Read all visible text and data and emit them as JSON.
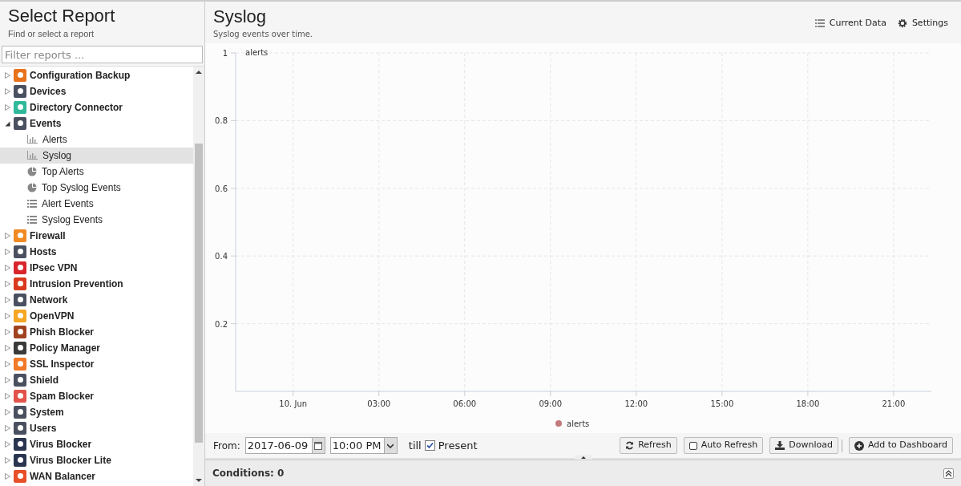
{
  "sidebar": {
    "title": "Select Report",
    "subtitle": "Find or select a report",
    "filter": {
      "placeholder": "Filter reports ..."
    },
    "items": [
      {
        "label": "Configuration Backup",
        "color": "#e8731c",
        "expanded": false
      },
      {
        "label": "Devices",
        "color": "#4a5060",
        "expanded": false
      },
      {
        "label": "Directory Connector",
        "color": "#2fb99a",
        "expanded": false
      },
      {
        "label": "Events",
        "color": "#4a5060",
        "expanded": true,
        "children": [
          {
            "label": "Alerts",
            "kind": "bar",
            "selected": false
          },
          {
            "label": "Syslog",
            "kind": "bar",
            "selected": true
          },
          {
            "label": "Top Alerts",
            "kind": "pie",
            "selected": false
          },
          {
            "label": "Top Syslog Events",
            "kind": "pie",
            "selected": false
          },
          {
            "label": "Alert Events",
            "kind": "list",
            "selected": false
          },
          {
            "label": "Syslog Events",
            "kind": "list",
            "selected": false
          }
        ]
      },
      {
        "label": "Firewall",
        "color": "#f08a24",
        "expanded": false
      },
      {
        "label": "Hosts",
        "color": "#4a5060",
        "expanded": false
      },
      {
        "label": "IPsec VPN",
        "color": "#d9262c",
        "expanded": false
      },
      {
        "label": "Intrusion Prevention",
        "color": "#d93a1e",
        "expanded": false
      },
      {
        "label": "Network",
        "color": "#4a5060",
        "expanded": false
      },
      {
        "label": "OpenVPN",
        "color": "#f5a623",
        "expanded": false
      },
      {
        "label": "Phish Blocker",
        "color": "#a0421e",
        "expanded": false
      },
      {
        "label": "Policy Manager",
        "color": "#3a3a3a",
        "expanded": false
      },
      {
        "label": "SSL Inspector",
        "color": "#f07a2a",
        "expanded": false
      },
      {
        "label": "Shield",
        "color": "#4a5060",
        "expanded": false
      },
      {
        "label": "Spam Blocker",
        "color": "#e2534a",
        "expanded": false
      },
      {
        "label": "System",
        "color": "#4a5060",
        "expanded": false
      },
      {
        "label": "Users",
        "color": "#4a5060",
        "expanded": false
      },
      {
        "label": "Virus Blocker",
        "color": "#2a3550",
        "expanded": false
      },
      {
        "label": "Virus Blocker Lite",
        "color": "#2a3550",
        "expanded": false
      },
      {
        "label": "WAN Balancer",
        "color": "#e8502a",
        "expanded": false
      }
    ]
  },
  "report": {
    "title": "Syslog",
    "subtitle": "Syslog events over time.",
    "actions": [
      {
        "label": "Current Data",
        "kind": "list"
      },
      {
        "label": "Settings",
        "kind": "gear"
      }
    ],
    "chart_data": {
      "type": "line",
      "series": [
        {
          "name": "alerts",
          "color": "#c27a7a",
          "values": [
            null,
            null,
            null,
            null,
            null,
            null,
            null,
            null
          ]
        }
      ],
      "ylim": [
        0,
        1
      ],
      "yticks": [
        0.2,
        0.4,
        0.6,
        0.8,
        1
      ],
      "grid": true,
      "categories": [
        "10. Jun",
        "03:00",
        "06:00",
        "09:00",
        "12:00",
        "15:00",
        "18:00",
        "21:00"
      ]
    }
  },
  "toolbar": {
    "from_label": "From:",
    "date": "2017-06-09",
    "time": "10:00 PM",
    "till_label": "till",
    "present": {
      "label": "Present",
      "checked": true
    },
    "buttons": [
      {
        "label": "Refresh",
        "kind": "refresh"
      },
      {
        "label": "Auto Refresh",
        "kind": "checkbox",
        "checked": false
      },
      {
        "label": "Download",
        "kind": "download"
      },
      {
        "label": "Add to Dashboard",
        "kind": "add"
      }
    ]
  },
  "conditions": {
    "label": "Conditions: 0"
  }
}
